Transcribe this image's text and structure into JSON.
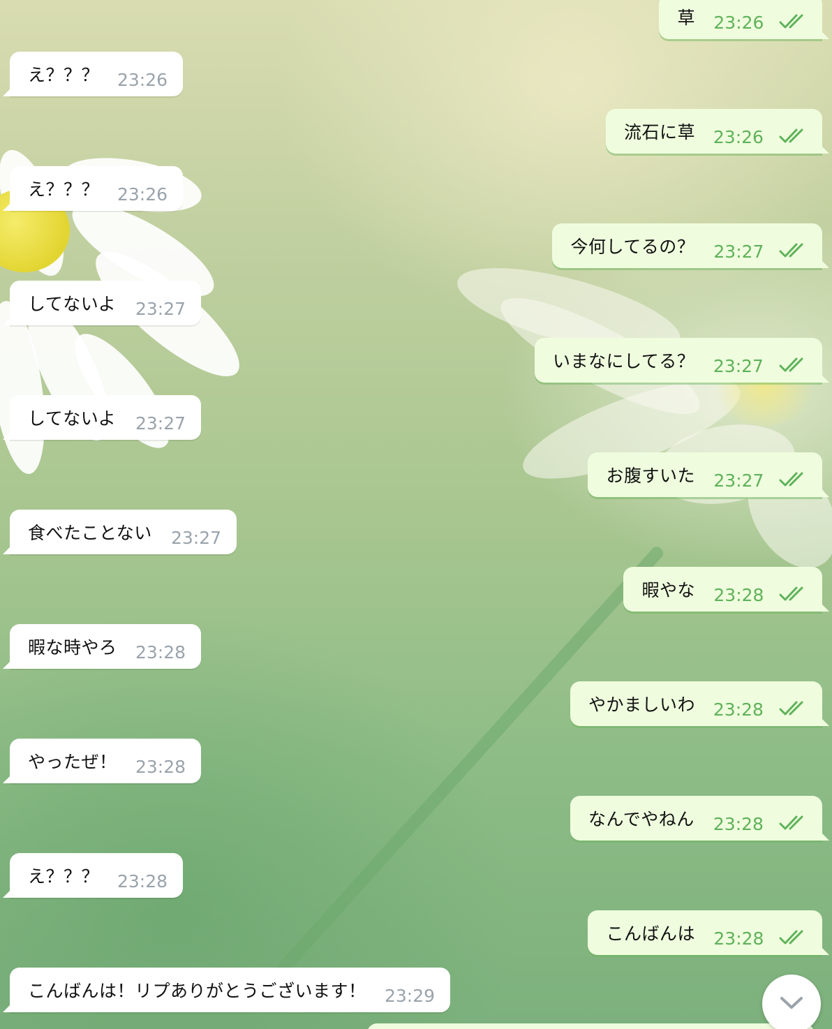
{
  "chat": {
    "messages": [
      {
        "dir": "out",
        "text": "草",
        "time": "23:26",
        "status": "read"
      },
      {
        "dir": "in",
        "text": "え？？？",
        "time": "23:26"
      },
      {
        "dir": "out",
        "text": "流石に草",
        "time": "23:26",
        "status": "read"
      },
      {
        "dir": "in",
        "text": "え？？？",
        "time": "23:26"
      },
      {
        "dir": "out",
        "text": "今何してるの？",
        "time": "23:27",
        "status": "read"
      },
      {
        "dir": "in",
        "text": "してないよ",
        "time": "23:27"
      },
      {
        "dir": "out",
        "text": "いまなにしてる？",
        "time": "23:27",
        "status": "read"
      },
      {
        "dir": "in",
        "text": "してないよ",
        "time": "23:27"
      },
      {
        "dir": "out",
        "text": "お腹すいた",
        "time": "23:27",
        "status": "read"
      },
      {
        "dir": "in",
        "text": "食べたことない",
        "time": "23:27"
      },
      {
        "dir": "out",
        "text": "暇やな",
        "time": "23:28",
        "status": "read"
      },
      {
        "dir": "in",
        "text": "暇な時やろ",
        "time": "23:28"
      },
      {
        "dir": "out",
        "text": "やかましいわ",
        "time": "23:28",
        "status": "read"
      },
      {
        "dir": "in",
        "text": "やったぜ！",
        "time": "23:28"
      },
      {
        "dir": "out",
        "text": "なんでやねん",
        "time": "23:28",
        "status": "read"
      },
      {
        "dir": "in",
        "text": "え？？？",
        "time": "23:28"
      },
      {
        "dir": "out",
        "text": "こんばんは",
        "time": "23:28",
        "status": "read"
      },
      {
        "dir": "in",
        "text": "こんばんは！リプありがとうございます！",
        "time": "23:29"
      }
    ]
  },
  "colors": {
    "incoming_bubble": "#ffffff",
    "outgoing_bubble": "#effdde",
    "outgoing_time": "#5fb25a",
    "incoming_time": "#9aa3ab",
    "read_ticks": "#5fb25a"
  },
  "icons": {
    "read_status": "double-check-icon",
    "scroll_down": "chevron-down-icon"
  }
}
